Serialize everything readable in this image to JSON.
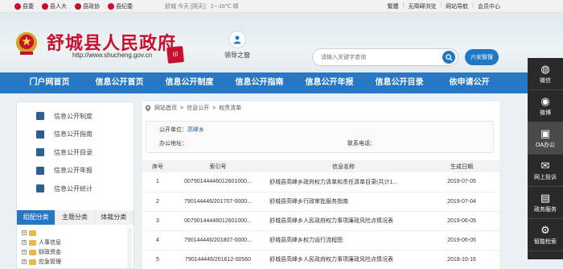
{
  "topbar": {
    "links": [
      {
        "label": "县委",
        "icon": "party-emblem-icon"
      },
      {
        "label": "县人大",
        "icon": "national-emblem-icon"
      },
      {
        "label": "县政协",
        "icon": "cppcc-emblem-icon"
      },
      {
        "label": "县纪委",
        "icon": "discipline-emblem-icon"
      }
    ],
    "weather": "舒城   今天 [阴天]：1~-16℃ 晴",
    "right_links": [
      "繁體",
      "无障碍浏览",
      "网站导航",
      "会员中心"
    ]
  },
  "header": {
    "title": "舒城县人民政府",
    "url": "http://www.shucheng.gov.cn",
    "seal_text": "印",
    "leader_label": "领导之窗",
    "search_placeholder": "请输入关键字查询",
    "region_button": "六安智搜"
  },
  "nav": {
    "items": [
      "门户网首页",
      "信息公开首页",
      "信息公开制度",
      "信息公开指南",
      "信息公开年报",
      "信息公开目录",
      "依申请公开"
    ]
  },
  "sidebar": {
    "items": [
      {
        "label": "信息公开制度",
        "icon": "document-icon"
      },
      {
        "label": "信息公开指南",
        "icon": "book-icon"
      },
      {
        "label": "信息公开目录",
        "icon": "catalog-icon"
      },
      {
        "label": "信息公开年报",
        "icon": "report-icon"
      },
      {
        "label": "信息公开统计",
        "icon": "stats-icon"
      }
    ],
    "tabs": [
      "组配分类",
      "主题分类",
      "体裁分类"
    ],
    "tree": [
      "",
      "人事信息",
      "财政资金",
      "应急管理"
    ]
  },
  "main": {
    "breadcrumb": [
      "网站首页",
      "信息公开",
      "权责清单"
    ],
    "unit_label": "公开单位：",
    "unit_value": "高峰乡",
    "address_label": "办公地址：",
    "phone_label": "联系电话：",
    "table": {
      "headers": [
        "序号",
        "索引号",
        "信息名称",
        "生成日期"
      ],
      "rows": [
        [
          "1",
          "00790144446012601000...",
          "舒城县高峰乡政府权力清单和责任清单目录(共计1...",
          "2019-07-05"
        ],
        [
          "2",
          "790144446/201707-0000...",
          "舒城县高峰乡行政审批服务指南",
          "2019-07-04"
        ],
        [
          "3",
          "00790144446012601000...",
          "舒城县高峰乡人民政府权力事项廉政风险点情况表",
          "2019-06-05"
        ],
        [
          "4",
          "790144446/201807-0000...",
          "舒城县高峰乡权力运行流程图",
          "2019-06-05"
        ],
        [
          "5",
          "790144446/201612-00560",
          "舒城县高峰乡人民政府权力事项廉政风险点情况表",
          "2018-10-16"
        ]
      ]
    }
  },
  "float_bar": {
    "items": [
      {
        "label": "微信",
        "icon": "wechat-icon"
      },
      {
        "label": "微博",
        "icon": "weibo-icon"
      },
      {
        "label": "OA办公",
        "icon": "outlook-icon"
      },
      {
        "label": "网上投诉",
        "icon": "complaint-icon"
      },
      {
        "label": "政务服务",
        "icon": "service-icon"
      },
      {
        "label": "智能检索",
        "icon": "smart-search-icon"
      }
    ]
  },
  "colors": {
    "brand_red": "#c8102e",
    "nav_blue": "#2778c4"
  }
}
